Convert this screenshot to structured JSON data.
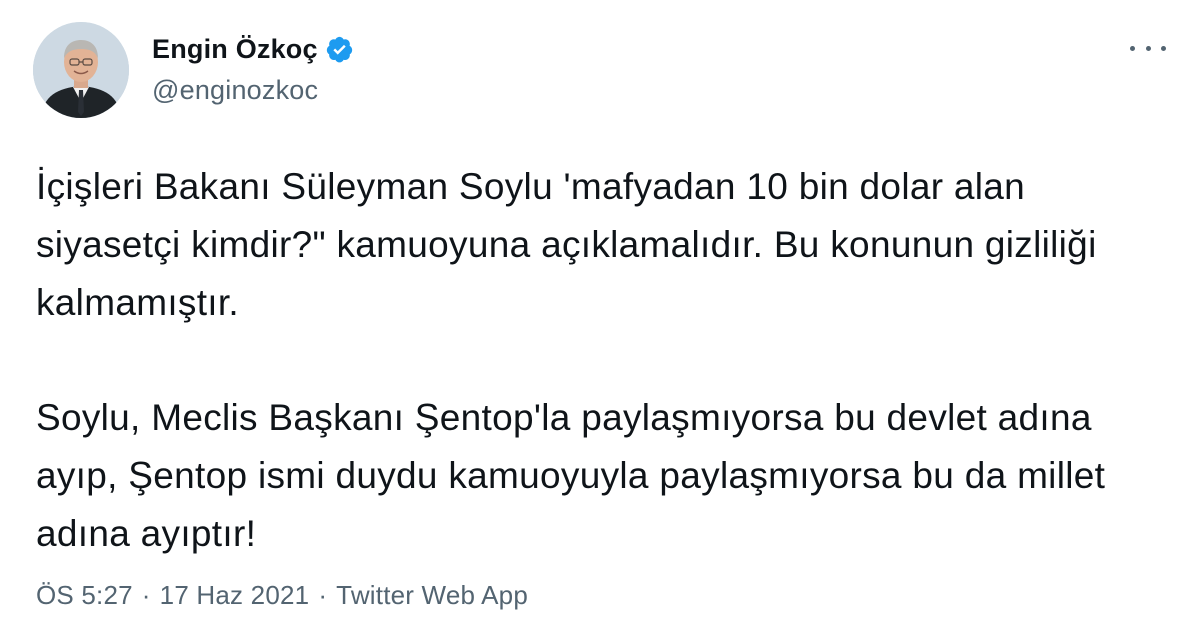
{
  "author": {
    "name": "Engin Özkoç",
    "handle": "@enginozkoc",
    "verified": true
  },
  "tweet": {
    "paragraphs": [
      "İçişleri Bakanı Süleyman Soylu 'mafyadan 10 bin dolar alan siyasetçi kimdir?\" kamuoyuna açıklamalıdır. Bu konunun gizliliği kalmamıştır.",
      "Soylu, Meclis Başkanı Şentop'la paylaşmıyorsa bu devlet adına ayıp, Şentop ismi duydu kamuoyuyla paylaşmıyorsa bu da millet adına ayıptır!"
    ]
  },
  "meta": {
    "time": "ÖS 5:27",
    "separator": "·",
    "date": "17 Haz 2021",
    "source": "Twitter Web App"
  },
  "icons": {
    "more": "more-options-icon",
    "verified": "verified-badge-icon"
  },
  "colors": {
    "verified_blue": "#1d9bf0",
    "secondary_text": "#536471",
    "primary_text": "#0f1419"
  }
}
